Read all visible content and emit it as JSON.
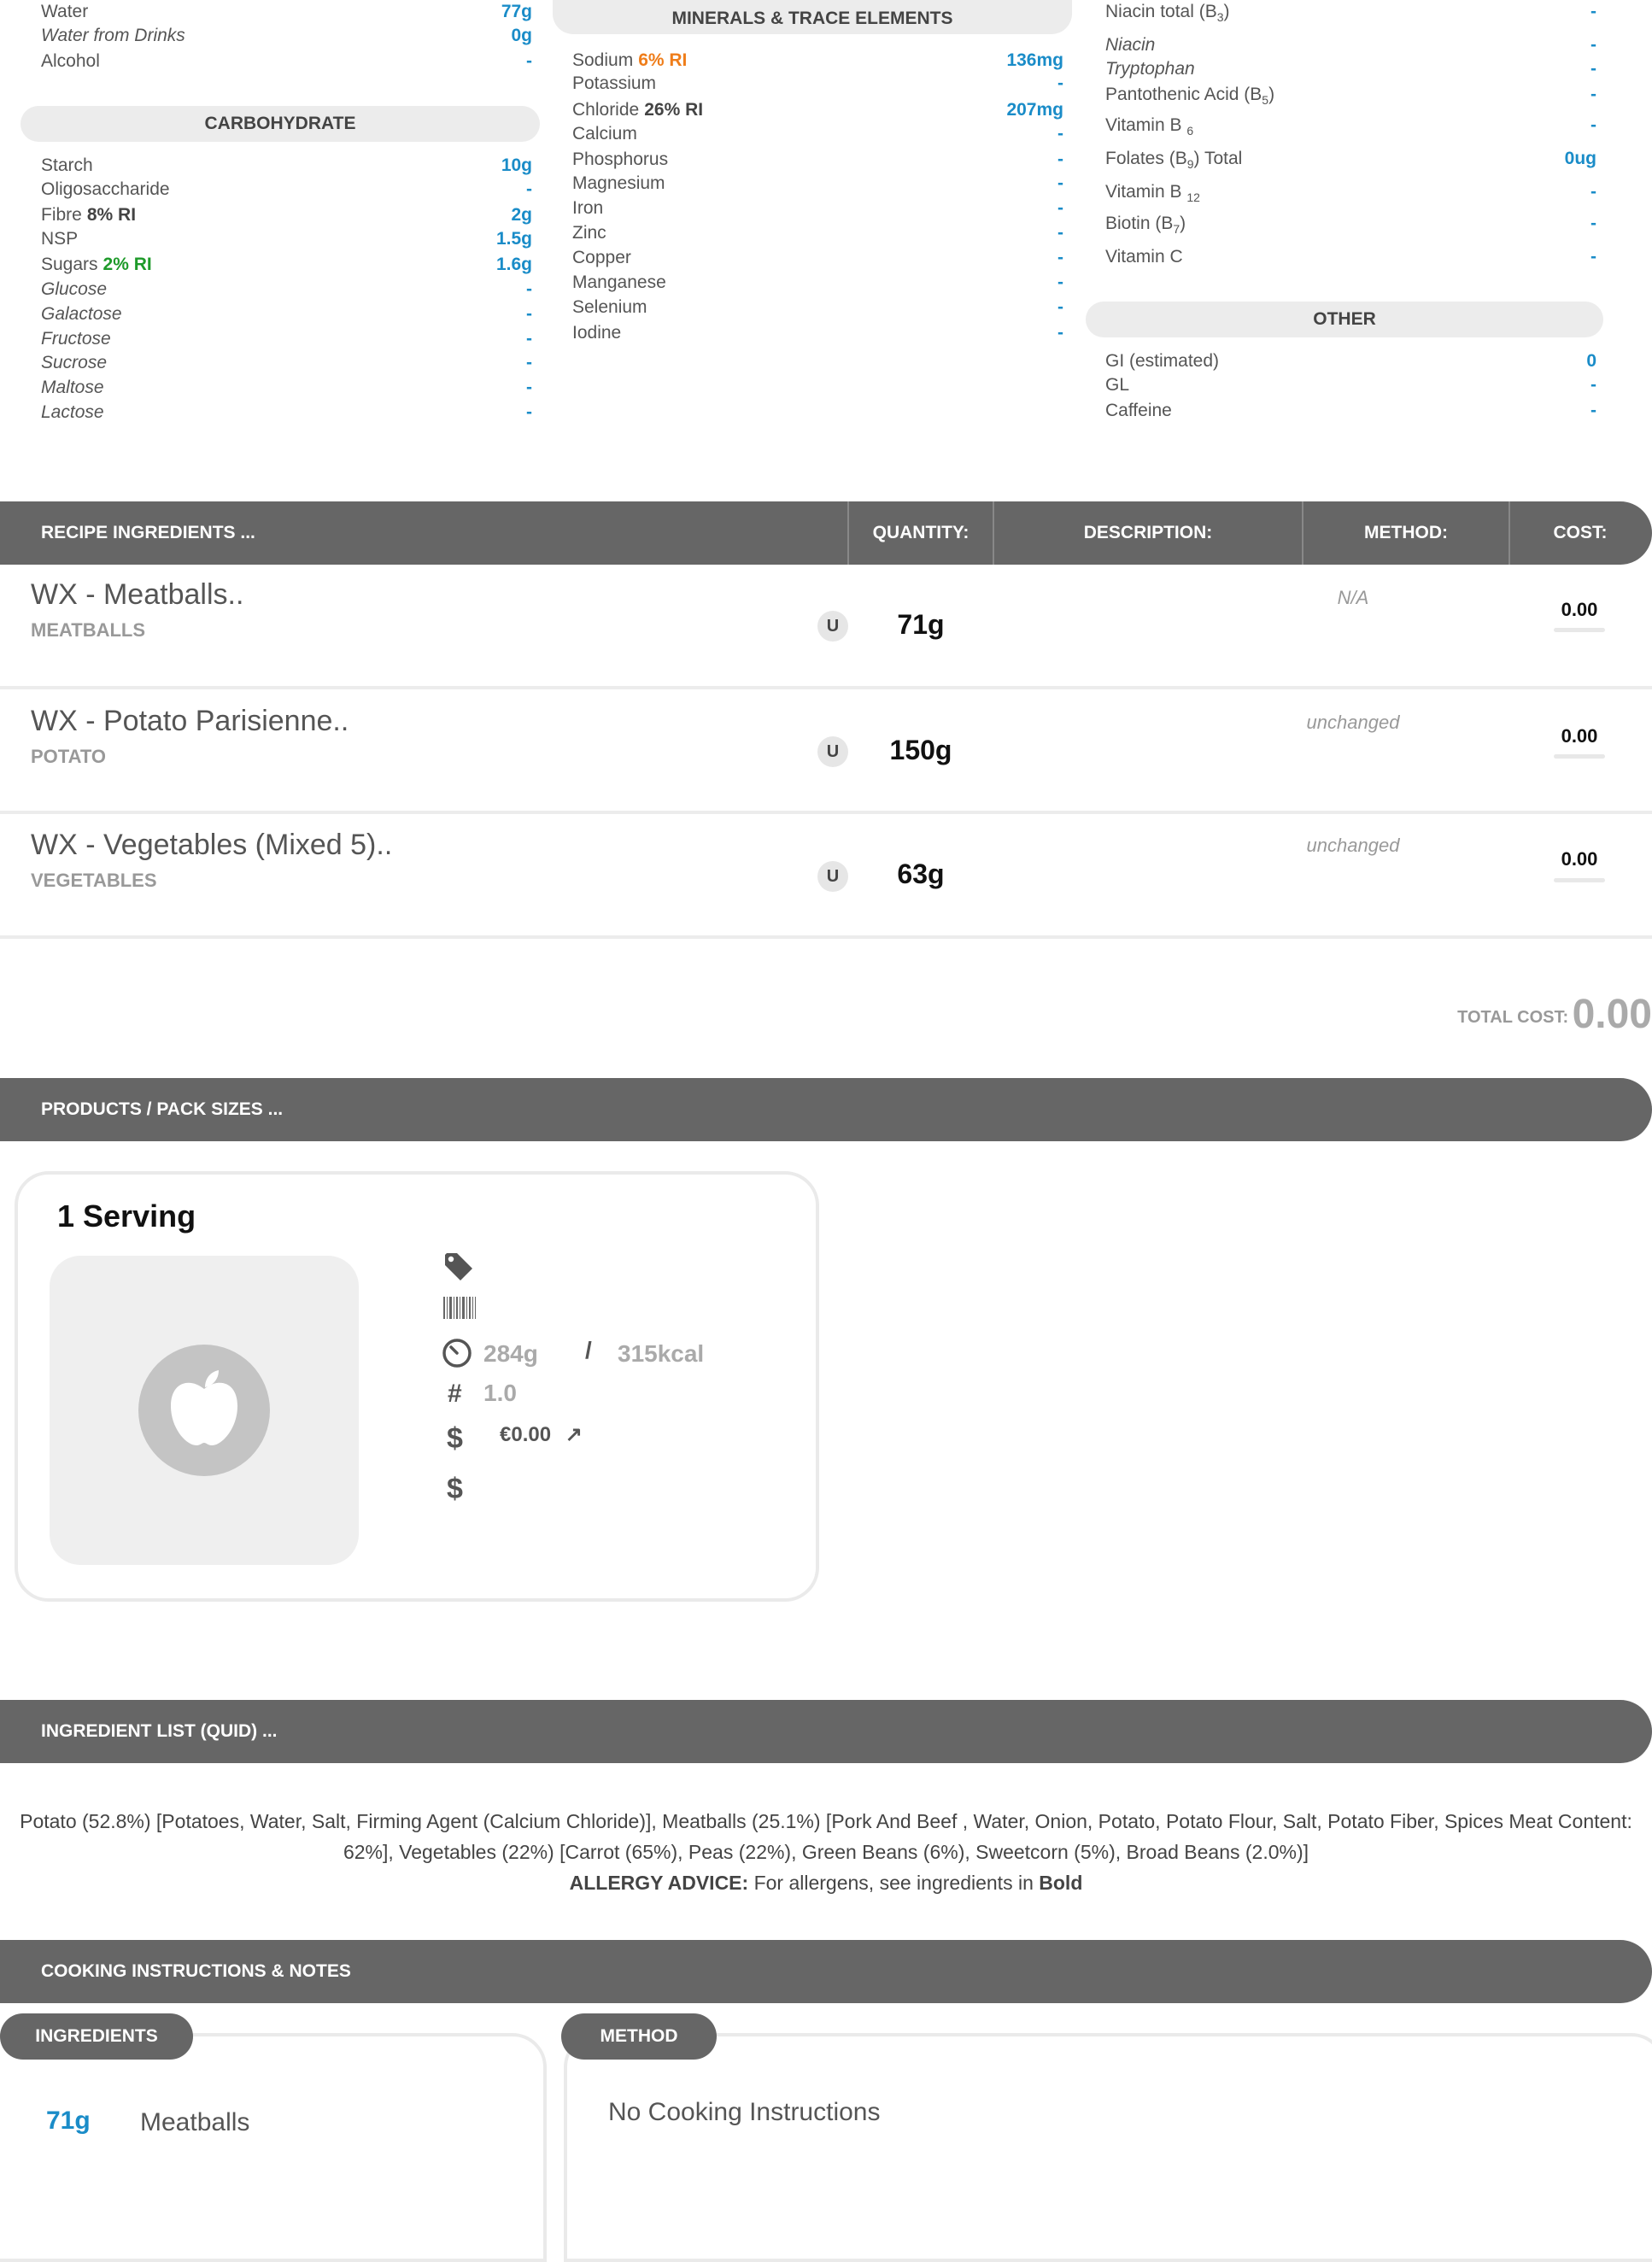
{
  "water_col": {
    "rows": [
      {
        "label": "Water",
        "value": "77g",
        "italic": false
      },
      {
        "label": "Water from Drinks",
        "value": "0g",
        "italic": true
      },
      {
        "label": "Alcohol",
        "value": "-",
        "italic": false
      }
    ]
  },
  "carbohydrate": {
    "header": "CARBOHYDRATE",
    "rows": [
      {
        "label": "Starch",
        "value": "10g"
      },
      {
        "label": "Oligosaccharide",
        "value": "-"
      },
      {
        "label": "Fibre",
        "ri": "8% RI",
        "value": "2g"
      },
      {
        "label": "NSP",
        "value": "1.5g"
      },
      {
        "label": "Sugars",
        "ri": "2% RI",
        "value": "1.6g"
      },
      {
        "label": "Glucose",
        "value": "-"
      },
      {
        "label": "Galactose",
        "value": "-"
      },
      {
        "label": "Fructose",
        "value": "-"
      },
      {
        "label": "Sucrose",
        "value": "-"
      },
      {
        "label": "Maltose",
        "value": "-"
      },
      {
        "label": "Lactose",
        "value": "-"
      }
    ]
  },
  "minerals": {
    "header": "MINERALS & TRACE ELEMENTS",
    "rows": [
      {
        "label": "Sodium",
        "ri": "6% RI",
        "value": "136mg"
      },
      {
        "label": "Potassium",
        "value": "-"
      },
      {
        "label": "Chloride",
        "ri": "26% RI",
        "value": "207mg"
      },
      {
        "label": "Calcium",
        "value": "-"
      },
      {
        "label": "Phosphorus",
        "value": "-"
      },
      {
        "label": "Magnesium",
        "value": "-"
      },
      {
        "label": "Iron",
        "value": "-"
      },
      {
        "label": "Zinc",
        "value": "-"
      },
      {
        "label": "Copper",
        "value": "-"
      },
      {
        "label": "Manganese",
        "value": "-"
      },
      {
        "label": "Selenium",
        "value": "-"
      },
      {
        "label": "Iodine",
        "value": "-"
      }
    ]
  },
  "vitamins": {
    "rows": [
      {
        "label": "Niacin total (B",
        "sub": "3",
        "tail": ")",
        "value": "-"
      },
      {
        "label": "Niacin",
        "value": "-"
      },
      {
        "label": "Tryptophan",
        "value": "-"
      },
      {
        "label": "Pantothenic Acid (B",
        "sub": "5",
        "tail": ")",
        "value": "-"
      },
      {
        "label": "Vitamin B ",
        "sub": "6",
        "tail": "",
        "value": "-"
      },
      {
        "label": "Folates (B",
        "sub": "9",
        "tail": ") Total",
        "value": "0ug"
      },
      {
        "label": "Vitamin B ",
        "sub": "12",
        "tail": "",
        "value": "-"
      },
      {
        "label": "Biotin (B",
        "sub": "7",
        "tail": ")",
        "value": "-"
      },
      {
        "label": "Vitamin C",
        "value": "-"
      }
    ]
  },
  "other": {
    "header": "OTHER",
    "rows": [
      {
        "label": "GI (estimated)",
        "value": "0"
      },
      {
        "label": "GL",
        "value": "-"
      },
      {
        "label": "Caffeine",
        "value": "-"
      }
    ]
  },
  "recipe": {
    "header": "RECIPE INGREDIENTS ...",
    "columns": {
      "quantity": "QUANTITY:",
      "description": "DESCRIPTION:",
      "method": "METHOD:",
      "cost": "COST:"
    },
    "items": [
      {
        "name": "WX - Meatballs..",
        "category": "MEATBALLS",
        "unit": "U",
        "quantity": "71g",
        "method": "N/A",
        "cost": "0.00"
      },
      {
        "name": "WX - Potato Parisienne..",
        "category": "POTATO",
        "unit": "U",
        "quantity": "150g",
        "method": "unchanged",
        "cost": "0.00"
      },
      {
        "name": "WX - Vegetables (Mixed 5)..",
        "category": "VEGETABLES",
        "unit": "U",
        "quantity": "63g",
        "method": "unchanged",
        "cost": "0.00"
      }
    ],
    "total_label": "TOTAL COST:",
    "total_value": "0.00"
  },
  "products": {
    "header": "PRODUCTS / PACK SIZES ...",
    "card": {
      "title": "1 Serving",
      "weight": "284g",
      "slash": "/",
      "energy": "315kcal",
      "hash": "#",
      "count": "1.0",
      "dollar": "$",
      "price": "€0.00",
      "price_arrow": "↗"
    }
  },
  "ingredient_list": {
    "header": "INGREDIENT LIST (QUID) ...",
    "text_line1": "Potato (52.8%) [Potatoes, Water, Salt, Firming Agent (Calcium Chloride)], Meatballs (25.1%) [Pork And Beef , Water, Onion, Potato, Potato Flour, Salt, Potato Fiber, Spices Meat Content:",
    "text_line2": "62%], Vegetables (22%) [Carrot (65%), Peas (22%), Green Beans (6%), Sweetcorn (5%), Broad Beans (2.0%)]",
    "allergy_label": "ALLERGY ADVICE:",
    "allergy_text": " For allergens, see ingredients in ",
    "allergy_bold": "Bold"
  },
  "cooking": {
    "header": "COOKING INSTRUCTIONS & NOTES",
    "ingredients_tab": "INGREDIENTS",
    "method_tab": "METHOD",
    "ingredient_qty": "71g",
    "ingredient_name": "Meatballs",
    "method_text": "No Cooking Instructions"
  },
  "colors": {
    "accent_blue": "#1a8cc8",
    "ri_orange": "#ef7d1a",
    "ri_green": "#1e9a2a",
    "bar_grey": "#666666"
  }
}
